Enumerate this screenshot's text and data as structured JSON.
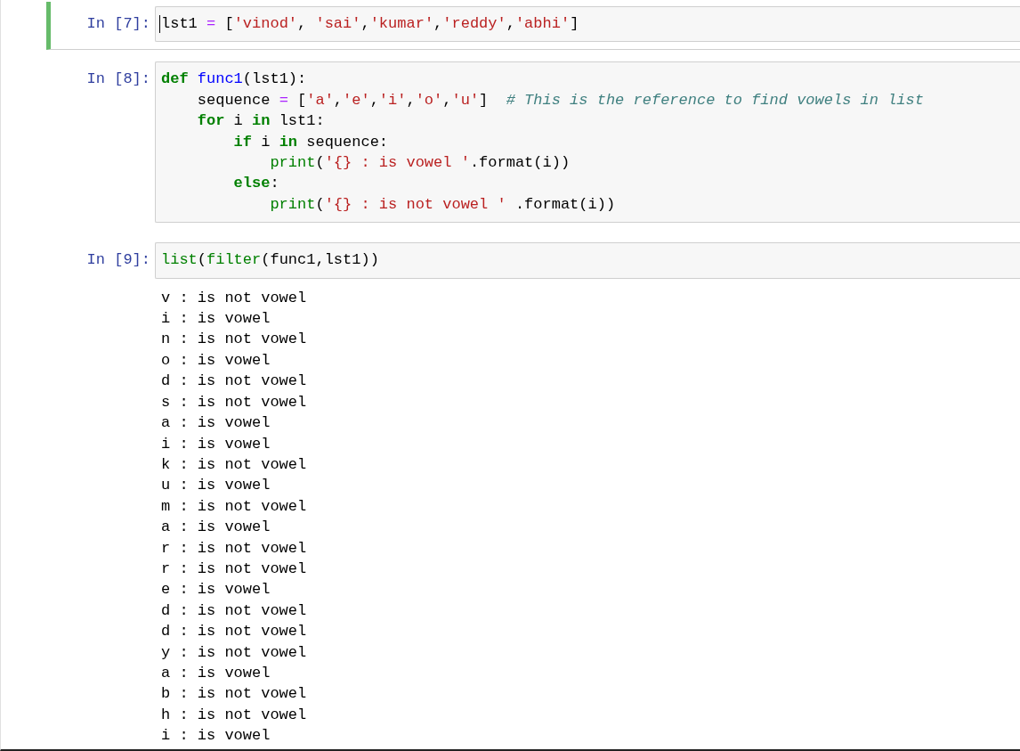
{
  "cells": [
    {
      "prompt": "In [7]:",
      "selected": true,
      "lines": [
        [
          {
            "text": "lst1 ",
            "kind": "plain"
          },
          {
            "text": "=",
            "kind": "op"
          },
          {
            "text": " [",
            "kind": "plain"
          },
          {
            "text": "'vinod'",
            "kind": "str"
          },
          {
            "text": ", ",
            "kind": "plain"
          },
          {
            "text": "'sai'",
            "kind": "str"
          },
          {
            "text": ",",
            "kind": "plain"
          },
          {
            "text": "'kumar'",
            "kind": "str"
          },
          {
            "text": ",",
            "kind": "plain"
          },
          {
            "text": "'reddy'",
            "kind": "str"
          },
          {
            "text": ",",
            "kind": "plain"
          },
          {
            "text": "'abhi'",
            "kind": "str"
          },
          {
            "text": "]",
            "kind": "plain"
          }
        ]
      ]
    },
    {
      "prompt": "In [8]:",
      "selected": false,
      "lines": [
        [
          {
            "text": "def",
            "kind": "kw"
          },
          {
            "text": " func1",
            "kind": "func"
          },
          {
            "text": "(lst1):",
            "kind": "plain"
          }
        ],
        [
          {
            "text": "    sequence ",
            "kind": "plain"
          },
          {
            "text": "=",
            "kind": "op"
          },
          {
            "text": " [",
            "kind": "plain"
          },
          {
            "text": "'a'",
            "kind": "str"
          },
          {
            "text": ",",
            "kind": "plain"
          },
          {
            "text": "'e'",
            "kind": "str"
          },
          {
            "text": ",",
            "kind": "plain"
          },
          {
            "text": "'i'",
            "kind": "str"
          },
          {
            "text": ",",
            "kind": "plain"
          },
          {
            "text": "'o'",
            "kind": "str"
          },
          {
            "text": ",",
            "kind": "plain"
          },
          {
            "text": "'u'",
            "kind": "str"
          },
          {
            "text": "]  ",
            "kind": "plain"
          },
          {
            "text": "# This is the reference to find vowels in list",
            "kind": "comment"
          }
        ],
        [
          {
            "text": "    for",
            "kind": "kw"
          },
          {
            "text": " i ",
            "kind": "plain"
          },
          {
            "text": "in",
            "kind": "kw"
          },
          {
            "text": " lst1:",
            "kind": "plain"
          }
        ],
        [
          {
            "text": "        if",
            "kind": "kw"
          },
          {
            "text": " i ",
            "kind": "plain"
          },
          {
            "text": "in",
            "kind": "kw"
          },
          {
            "text": " sequence:",
            "kind": "plain"
          }
        ],
        [
          {
            "text": "            print",
            "kind": "builtin"
          },
          {
            "text": "(",
            "kind": "plain"
          },
          {
            "text": "'{} : is vowel '",
            "kind": "str"
          },
          {
            "text": ".format(i))",
            "kind": "plain"
          }
        ],
        [
          {
            "text": "        else",
            "kind": "kw"
          },
          {
            "text": ":",
            "kind": "plain"
          }
        ],
        [
          {
            "text": "            print",
            "kind": "builtin"
          },
          {
            "text": "(",
            "kind": "plain"
          },
          {
            "text": "'{} : is not vowel '",
            "kind": "str"
          },
          {
            "text": " .format(i))",
            "kind": "plain"
          }
        ]
      ]
    },
    {
      "prompt": "In [9]:",
      "selected": false,
      "lines": [
        [
          {
            "text": "list",
            "kind": "builtin"
          },
          {
            "text": "(",
            "kind": "plain"
          },
          {
            "text": "filter",
            "kind": "builtin"
          },
          {
            "text": "(func1,lst1))",
            "kind": "plain"
          }
        ]
      ],
      "output": [
        "v : is not vowel",
        "i : is vowel",
        "n : is not vowel",
        "o : is vowel",
        "d : is not vowel",
        "s : is not vowel",
        "a : is vowel",
        "i : is vowel",
        "k : is not vowel",
        "u : is vowel",
        "m : is not vowel",
        "a : is vowel",
        "r : is not vowel",
        "r : is not vowel",
        "e : is vowel",
        "d : is not vowel",
        "d : is not vowel",
        "y : is not vowel",
        "a : is vowel",
        "b : is not vowel",
        "h : is not vowel",
        "i : is vowel"
      ]
    }
  ]
}
